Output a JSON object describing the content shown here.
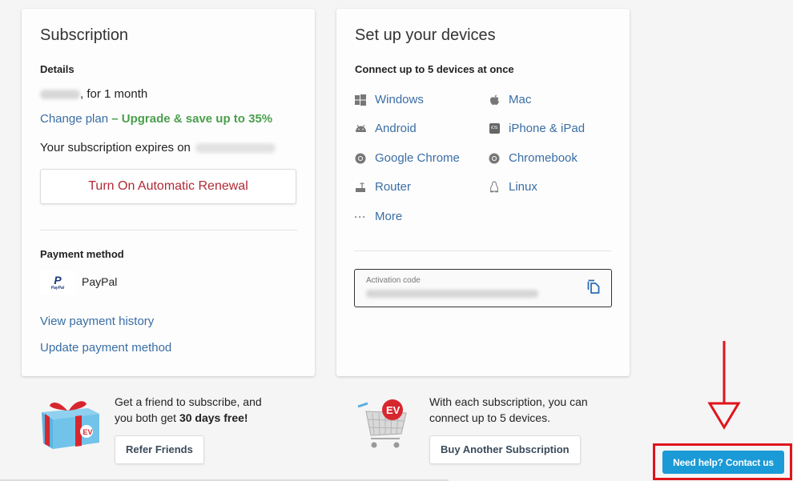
{
  "subscription": {
    "title": "Subscription",
    "details_label": "Details",
    "price_suffix": ", for 1 month",
    "change_plan_link": "Change plan",
    "upgrade_text": "– Upgrade & save up to 35%",
    "expires_text": "Your subscription expires on",
    "renew_button": "Turn On Automatic Renewal",
    "payment_method_label": "Payment method",
    "payment_method_name": "PayPal",
    "paypal_logo_text": "PayPal",
    "view_history_link": "View payment history",
    "update_method_link": "Update payment method"
  },
  "devices": {
    "title": "Set up your devices",
    "subtitle": "Connect up to 5 devices at once",
    "items": [
      {
        "label": "Windows",
        "icon": "windows-icon"
      },
      {
        "label": "Mac",
        "icon": "apple-icon"
      },
      {
        "label": "Android",
        "icon": "android-icon"
      },
      {
        "label": "iPhone & iPad",
        "icon": "ios-icon"
      },
      {
        "label": "Google Chrome",
        "icon": "chrome-icon"
      },
      {
        "label": "Chromebook",
        "icon": "chrome-icon"
      },
      {
        "label": "Router",
        "icon": "router-icon"
      },
      {
        "label": "Linux",
        "icon": "linux-icon"
      },
      {
        "label": "More",
        "icon": "more-icon"
      }
    ],
    "activation_label": "Activation code",
    "ios_badge": "iOS"
  },
  "promos": {
    "refer_line1": "Get a friend to subscribe, and",
    "refer_line2_prefix": "you both get ",
    "refer_line2_bold": "30 days free!",
    "refer_button": "Refer Friends",
    "buy_line1": "With each subscription, you can",
    "buy_line2": "connect up to 5 devices.",
    "buy_button": "Buy Another Subscription"
  },
  "help": {
    "button": "Need help? Contact us"
  },
  "colors": {
    "link": "#3a6ea5",
    "upgrade_green": "#4a9f4c",
    "renew_red": "#b02a35",
    "help_blue": "#1a9ad6",
    "annotation_red": "#e0141c"
  }
}
